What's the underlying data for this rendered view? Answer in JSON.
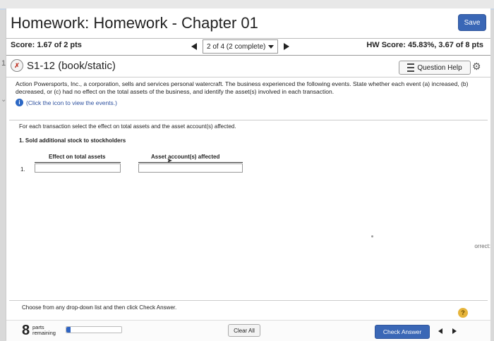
{
  "header": {
    "title": "Homework: Homework - Chapter 01",
    "save_label": "Save"
  },
  "score_bar": {
    "score_label": "Score:",
    "score_value": "1.67 of 2 pts",
    "pager_text": "2 of 4 (2 complete)",
    "hw_label": "HW Score:",
    "hw_value": "45.83%, 3.67 of 8 pts"
  },
  "question": {
    "side_mark": "1",
    "id": "S1-12 (book/static)",
    "help_label": "Question Help",
    "description": "Action Powersports, Inc., a corporation, sells and services personal watercraft. The business experienced the following events. State whether each event (a) increased, (b) decreased, or (c) had no effect on the total assets of the business, and identify the asset(s) involved in each transaction.",
    "info_text": "(Click the icon to view the events.)",
    "instruction": "For each transaction select the effect on total assets and the asset account(s) affected.",
    "transaction": "1. Sold additional stock to stockholders",
    "col_effect": "Effect on total assets",
    "col_account": "Asset account(s) affected",
    "row_number": "1.",
    "side_right": "orrect:"
  },
  "footer": {
    "choose_text": "Choose from any drop-down list and then click Check Answer.",
    "parts_count": "8",
    "parts_label_1": "parts",
    "parts_label_2": "remaining",
    "progress": 0.08,
    "clear_label": "Clear All",
    "check_label": "Check Answer",
    "help_mark": "?"
  },
  "colors": {
    "accent": "#3a67b6"
  }
}
